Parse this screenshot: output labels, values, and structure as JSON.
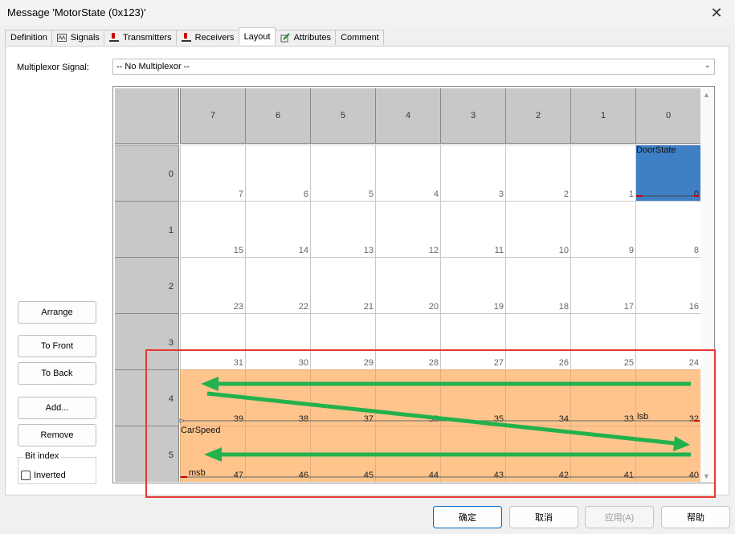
{
  "window": {
    "title": "Message 'MotorState (0x123)'"
  },
  "tabs": [
    {
      "label": "Definition",
      "icon": "none"
    },
    {
      "label": "Signals",
      "icon": "signals-icon"
    },
    {
      "label": "Transmitters",
      "icon": "transmitter-icon"
    },
    {
      "label": "Receivers",
      "icon": "receiver-icon"
    },
    {
      "label": "Layout",
      "icon": "none"
    },
    {
      "label": "Attributes",
      "icon": "attributes-icon"
    },
    {
      "label": "Comment",
      "icon": "none"
    }
  ],
  "multiplexor": {
    "label": "Multiplexor Signal:",
    "value": "-- No Multiplexor --"
  },
  "layout": {
    "columns": [
      "7",
      "6",
      "5",
      "4",
      "3",
      "2",
      "1",
      "0"
    ],
    "rows": [
      {
        "label": "0",
        "bits": [
          "7",
          "6",
          "5",
          "4",
          "3",
          "2",
          "1",
          "0"
        ]
      },
      {
        "label": "1",
        "bits": [
          "15",
          "14",
          "13",
          "12",
          "11",
          "10",
          "9",
          "8"
        ]
      },
      {
        "label": "2",
        "bits": [
          "23",
          "22",
          "21",
          "20",
          "19",
          "18",
          "17",
          "16"
        ]
      },
      {
        "label": "3",
        "bits": [
          "31",
          "30",
          "29",
          "28",
          "27",
          "26",
          "25",
          "24"
        ]
      },
      {
        "label": "4",
        "bits": [
          "39",
          "38",
          "37",
          "36",
          "35",
          "34",
          "33",
          "32"
        ]
      },
      {
        "label": "5",
        "bits": [
          "47",
          "46",
          "45",
          "44",
          "43",
          "42",
          "41",
          "40"
        ]
      }
    ],
    "signals": {
      "door_state": "DoorState",
      "car_speed": "CarSpeed",
      "lsb": "lsb",
      "msb": "msb"
    },
    "colors": {
      "car_speed": "#ffc48c",
      "door_state": "#3e7fc6",
      "highlight": "#e53935",
      "arrow": "#22b14c"
    }
  },
  "buttons": {
    "arrange": "Arrange",
    "to_front": "To Front",
    "to_back": "To Back",
    "add": "Add...",
    "remove": "Remove"
  },
  "bit_index": {
    "legend": "Bit index",
    "inverted": "Inverted"
  },
  "footer": {
    "ok": "确定",
    "cancel": "取消",
    "apply": "应用(A)",
    "help": "帮助"
  }
}
